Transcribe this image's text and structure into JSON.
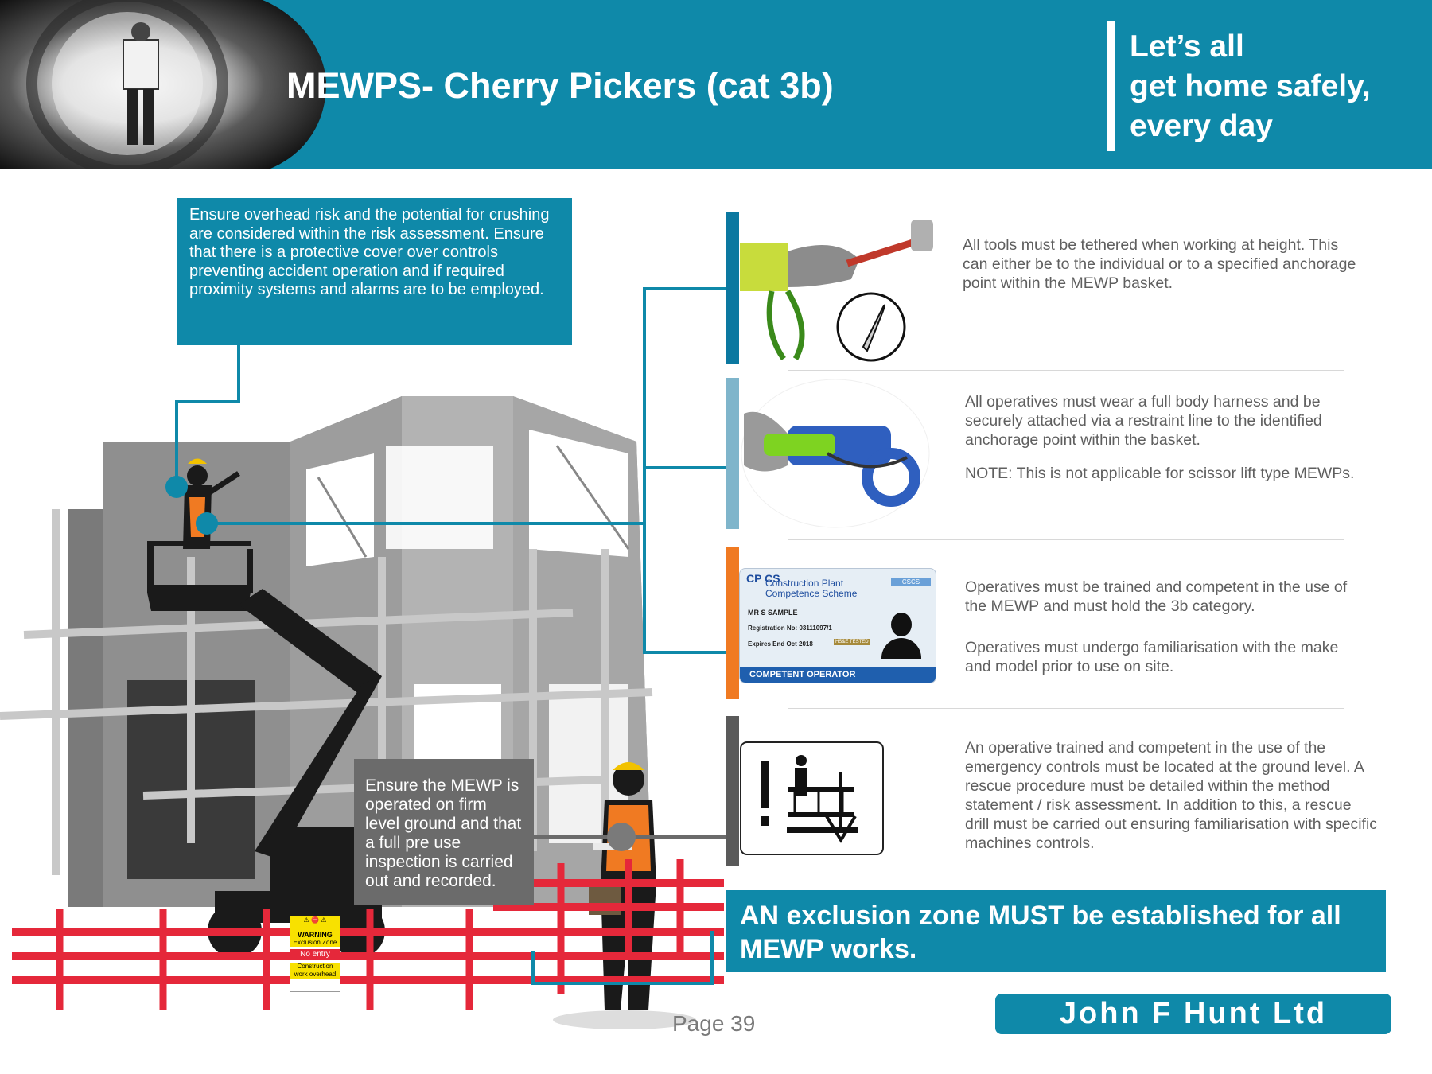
{
  "header": {
    "title": "MEWPS- Cherry Pickers (cat 3b)",
    "slogan": [
      "Let’s all",
      "get home safely,",
      "every day"
    ]
  },
  "callouts": {
    "overhead": "Ensure overhead risk and the potential for crushing are considered within the risk assessment. Ensure that there is a protective cover over controls preventing accident operation and if required proximity systems and alarms are to be employed.",
    "ground": "Ensure the MEWP is operated on firm level ground and that a full pre use inspection is carried out and recorded."
  },
  "items": [
    {
      "color": "#0b78a0",
      "icon": "tool-lanyard-icon",
      "text": [
        "All tools must be tethered when working at height. This can either be to the individual or to a specified anchorage point within the MEWP basket."
      ]
    },
    {
      "color": "#7fb5cb",
      "icon": "harness-hook-icon",
      "text": [
        "All operatives must wear a full body harness and be securely attached via a restraint line to the identified anchorage point within the basket.",
        "NOTE:  This is not applicable for scissor lift type MEWPs."
      ]
    },
    {
      "color": "#f07a22",
      "icon": "cpcs-card-icon",
      "text": [
        "Operatives must be trained and competent in the use of the MEWP and must hold the 3b category.",
        "Operatives must undergo familiarisation with the make and model prior to use on site."
      ]
    },
    {
      "color": "#5a5a5a",
      "icon": "emergency-lowering-icon",
      "text": [
        "An operative trained and competent in the use of the emergency controls must be located at the ground level. A rescue procedure must be detailed within the method statement / risk assessment. In addition to this, a rescue drill must be carried out ensuring familiarisation with specific machines controls."
      ]
    }
  ],
  "cpcs_card": {
    "scheme_line1": "Construction Plant",
    "scheme_line2": "Competence Scheme",
    "logo": "CP CS",
    "name": "MR S SAMPLE",
    "registration": "Registration No: 03111097/1",
    "expires": "Expires End  Oct 2018",
    "tested": "HS&E TESTED",
    "footer": "COMPETENT OPERATOR",
    "badge": "CSCS"
  },
  "warning_sign": {
    "title": "WARNING",
    "subtitle": "Exclusion Zone",
    "middle": "No entry",
    "bottom": "Construction work overhead"
  },
  "exclusion_banner": "AN exclusion zone MUST be established for all MEWP works.",
  "brand": "John F Hunt Ltd",
  "page": "Page 39",
  "colors": {
    "primary": "#0f89a9",
    "fence": "#e5283a",
    "grey_panel": "#6b6b6b"
  }
}
